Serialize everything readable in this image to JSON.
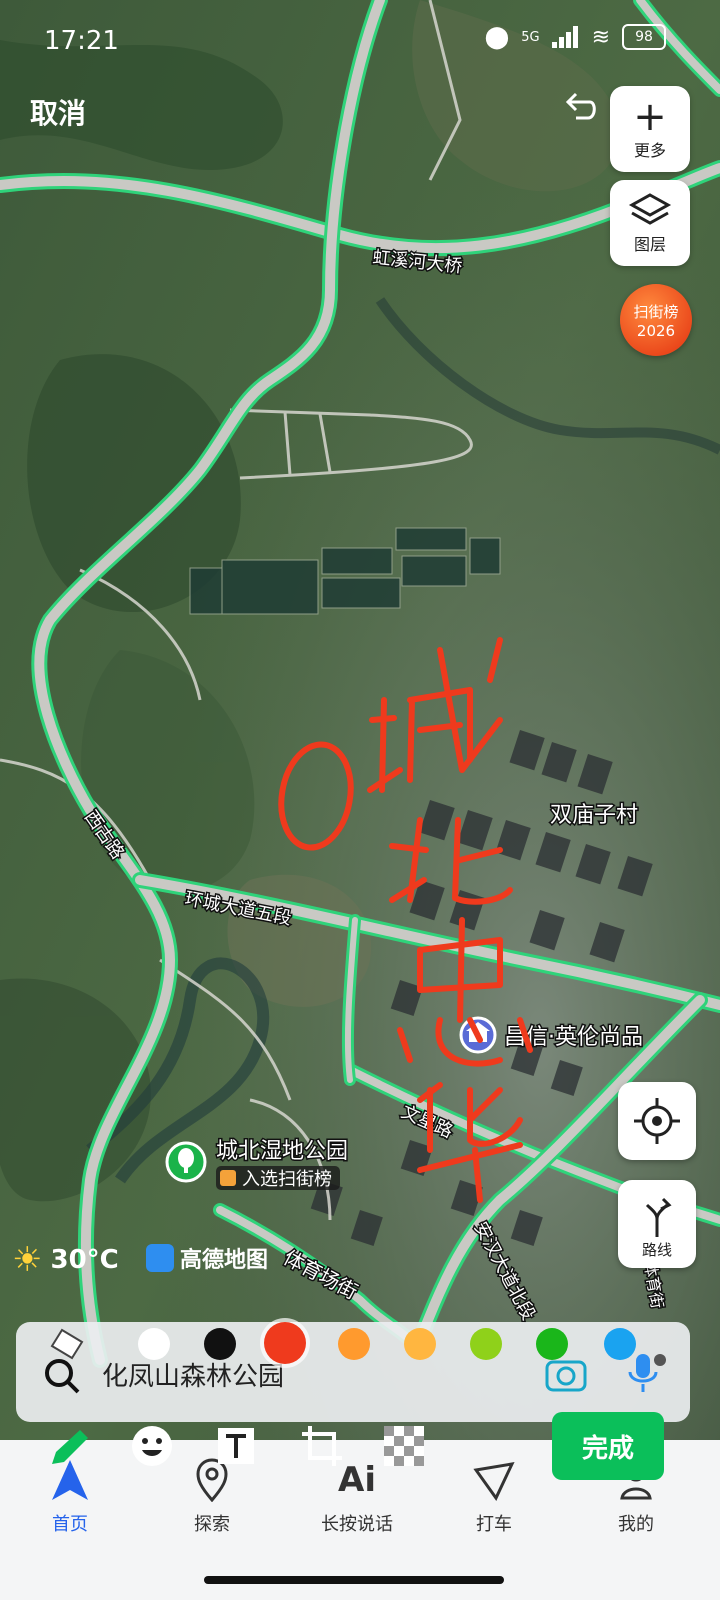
{
  "status_bar": {
    "time": "17:21",
    "network": "5G",
    "battery": "98"
  },
  "top": {
    "cancel_label": "取消"
  },
  "side": {
    "more_label": "更多",
    "layers_label": "图层",
    "scan_badge": [
      "扫街榜",
      "2026"
    ],
    "route_label": "路线"
  },
  "map": {
    "labels": {
      "bridge": "虹溪河大桥",
      "village": "双庙子村",
      "road_west": "西古路",
      "ring_road": "环城大道五段",
      "poi_residential": "昌信·英伦尚品",
      "road_wenxing": "文星路",
      "park": "城北湿地公园",
      "park_badge": "入选扫街榜",
      "road_tiyu": "体育场街",
      "road_anhan": "安汉大道北段",
      "road_tiyu2": "体育街"
    },
    "handwriting": "O城北忠华"
  },
  "weather": {
    "temp": "30°C",
    "brand": "高德地图"
  },
  "search": {
    "placeholder_text": "化凤山森林公园"
  },
  "colors": {
    "palette": [
      "#ffffff",
      "#111111",
      "#ef3a1d",
      "#ff9a2e",
      "#ffb640",
      "#8fd11a",
      "#1ab61a",
      "#1aa3f0"
    ],
    "selected": "#ef3a1d",
    "accent_green": "#0bbf5a",
    "route_green": "#2fd37a"
  },
  "tools": {
    "done_label": "完成"
  },
  "bottom_nav": {
    "tabs": [
      "首页",
      "探索",
      "长按说话",
      "打车",
      "我的"
    ],
    "active": "首页"
  }
}
